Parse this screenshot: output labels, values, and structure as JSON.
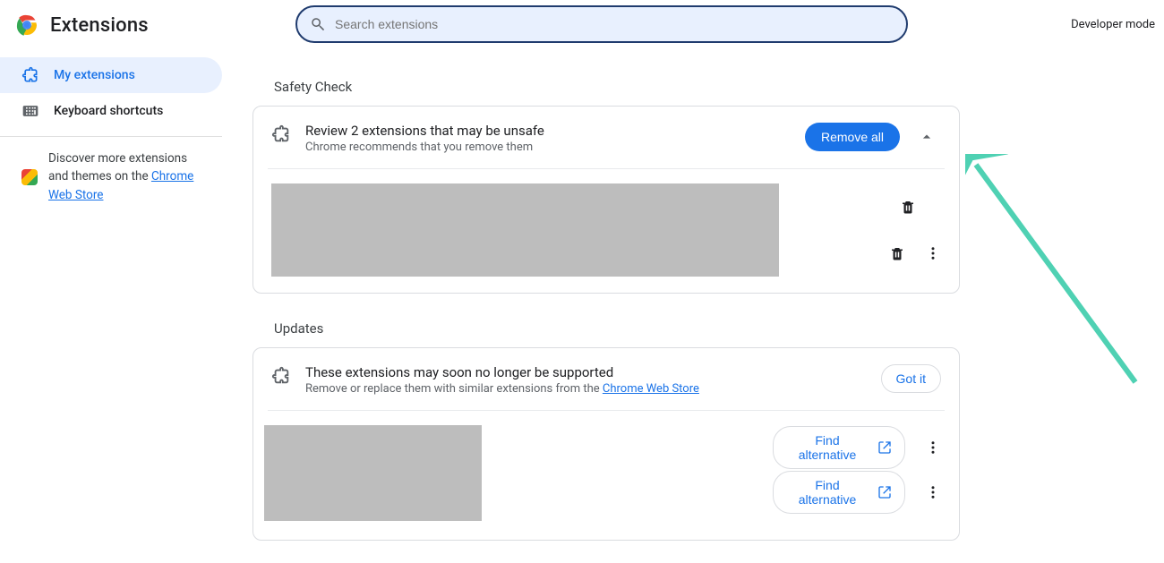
{
  "header": {
    "title": "Extensions",
    "search_placeholder": "Search extensions",
    "developer_mode_label": "Developer mode"
  },
  "sidebar": {
    "items": [
      {
        "label": "My extensions",
        "icon": "puzzle-icon",
        "active": true
      },
      {
        "label": "Keyboard shortcuts",
        "icon": "keyboard-icon",
        "active": false
      }
    ],
    "discover_prefix": "Discover more extensions and themes on the ",
    "discover_link": "Chrome Web Store"
  },
  "sections": {
    "safety": {
      "label": "Safety Check",
      "title": "Review 2 extensions that may be unsafe",
      "subtitle": "Chrome recommends that you remove them",
      "remove_all_label": "Remove all"
    },
    "updates": {
      "label": "Updates",
      "title": "These extensions may soon no longer be supported",
      "subtitle_prefix": "Remove or replace them with similar extensions from the ",
      "subtitle_link": "Chrome Web Store",
      "got_it_label": "Got it",
      "find_alt_label": "Find alternative"
    }
  }
}
